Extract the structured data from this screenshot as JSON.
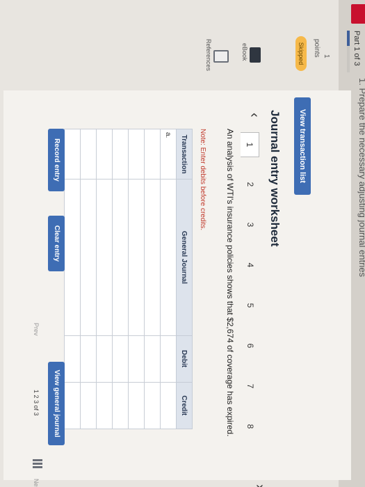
{
  "header": {
    "part": "Part 1 of 3",
    "heading_partial": "1. Prepare the necessary adjusting journal entries"
  },
  "question": {
    "number": "1",
    "points_label": "points",
    "status": "Skipped"
  },
  "side": {
    "ebook": "eBook",
    "references": "References"
  },
  "buttons": {
    "view_transactions": "View transaction list",
    "record": "Record entry",
    "clear": "Clear entry",
    "view_journal": "View general journal"
  },
  "worksheet": {
    "title": "Journal entry worksheet",
    "tabs": [
      "1",
      "2",
      "3",
      "4",
      "5",
      "6",
      "7",
      "8"
    ],
    "active_tab": 1,
    "description": "An analysis of WTI's insurance policies shows that $2,674 of coverage has expired.",
    "note": "Note: Enter debits before credits.",
    "columns": [
      "Transaction",
      "General Journal",
      "Debit",
      "Credit"
    ],
    "rows": [
      [
        "a.",
        "",
        "",
        ""
      ],
      [
        "",
        "",
        "",
        ""
      ],
      [
        "",
        "",
        "",
        ""
      ],
      [
        "",
        "",
        "",
        ""
      ],
      [
        "",
        "",
        "",
        ""
      ],
      [
        "",
        "",
        "",
        ""
      ],
      [
        "",
        "",
        "",
        ""
      ]
    ]
  },
  "pager": {
    "prev": "Prev",
    "pages": "1  2  3  of 3",
    "next": "Next"
  },
  "colors": {
    "accent": "#3e6db4",
    "skipped": "#f6b94a",
    "note": "#c0392b"
  }
}
